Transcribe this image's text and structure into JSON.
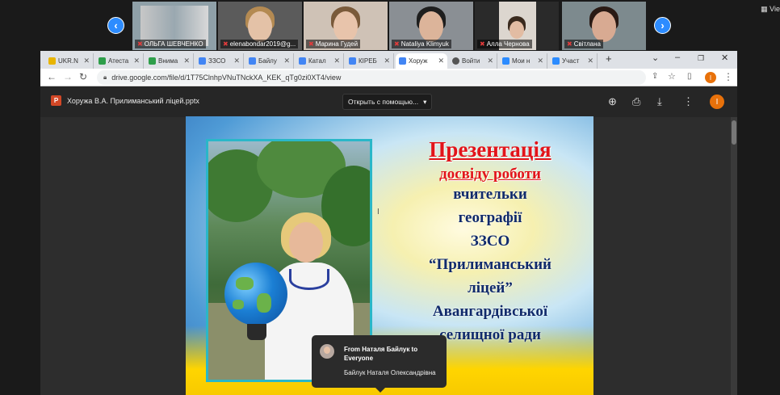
{
  "zoom": {
    "participants": [
      {
        "name": "ОЛЬГА ШЕВЧЕНКО",
        "muted": true
      },
      {
        "name": "elenabondar2019@g...",
        "muted": true
      },
      {
        "name": "Марина Гудей",
        "muted": true
      },
      {
        "name": "Nataliya Klimyuk",
        "muted": true
      },
      {
        "name": "Алла Чернова",
        "muted": true
      },
      {
        "name": "Світлана",
        "muted": true
      }
    ],
    "view_label": "Vie",
    "prev_icon": "chevron-left-icon",
    "next_icon": "chevron-right-icon"
  },
  "browser": {
    "tabs": [
      {
        "label": "UKR.N",
        "color": "#e8b400"
      },
      {
        "label": "Атеста",
        "color": "#2e9e4a"
      },
      {
        "label": "Внима",
        "color": "#2e9e4a"
      },
      {
        "label": "ЗЗСО",
        "color": "#4285f4"
      },
      {
        "label": "Байлу",
        "color": "#4285f4"
      },
      {
        "label": "Катал",
        "color": "#4285f4"
      },
      {
        "label": "КІРЕБ",
        "color": "#4285f4"
      },
      {
        "label": "Хоруж",
        "color": "#4285f4",
        "active": true
      },
      {
        "label": "Войти",
        "color": "#555555"
      },
      {
        "label": "Мои н",
        "color": "#2d8cff"
      },
      {
        "label": "Участ",
        "color": "#2d8cff"
      }
    ],
    "new_tab": "+",
    "url": "drive.google.com/file/d/1T75ClnhpVNuTNckXA_KEK_qTg0zi0XT4/view",
    "profile_initial": "I"
  },
  "viewer": {
    "file_name": "Хоружа В.А. Прилиманський ліцей.pptx",
    "file_badge": "P",
    "open_with": "Открыть с помощью...",
    "profile_initial": "I"
  },
  "slide": {
    "title": "Презентація",
    "subtitle": "досвіду роботи",
    "lines": [
      "вчительки",
      "географії",
      "ЗЗСО",
      "“Прилиманський",
      "ліцей”",
      "Авангардівської",
      "селищної ради"
    ]
  },
  "chat": {
    "from": "From Наталя Байлук to Everyone",
    "message": "Байлук Наталя Олександрівна"
  }
}
